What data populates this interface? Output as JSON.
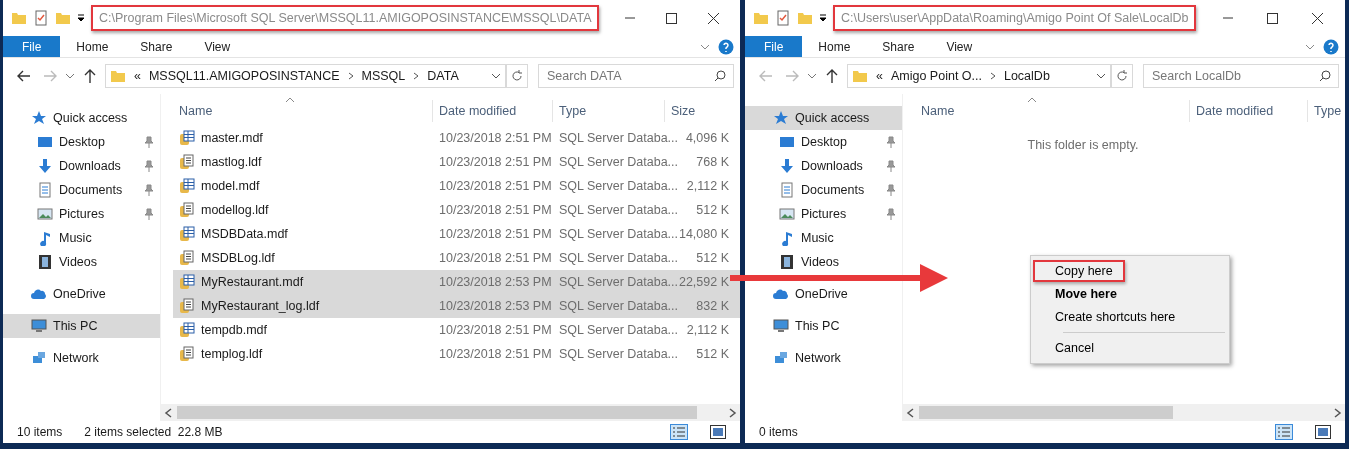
{
  "windows": [
    {
      "title_path": "C:\\Program Files\\Microsoft SQL Server\\MSSQL11.AMIGOPOSINSTANCE\\MSSQL\\DATA",
      "path_highlighted": true,
      "ribbon_tabs": [
        {
          "label": "File",
          "kind": "file"
        },
        {
          "label": "Home",
          "kind": "tab"
        },
        {
          "label": "Share",
          "kind": "tab"
        },
        {
          "label": "View",
          "kind": "tab"
        }
      ],
      "back_enabled": true,
      "breadcrumbs": [
        "«",
        "MSSQL11.AMIGOPOSINSTANCE",
        "MSSQL",
        "DATA"
      ],
      "search": {
        "placeholder": "Search DATA"
      },
      "sidebar": [
        {
          "label": "Quick access",
          "kind": "star",
          "selected": false,
          "children": [
            {
              "label": "Desktop",
              "kind": "desktop",
              "pinned": true,
              "selected": false
            },
            {
              "label": "Downloads",
              "kind": "download",
              "pinned": true,
              "selected": false
            },
            {
              "label": "Documents",
              "kind": "document",
              "pinned": true,
              "selected": false
            },
            {
              "label": "Pictures",
              "kind": "pictures",
              "pinned": true,
              "selected": false
            },
            {
              "label": "Music",
              "kind": "music",
              "pinned": false,
              "selected": false
            },
            {
              "label": "Videos",
              "kind": "video",
              "pinned": false,
              "selected": false
            }
          ]
        },
        {
          "label": "OneDrive",
          "kind": "cloud",
          "selected": false
        },
        {
          "label": "This PC",
          "kind": "pc",
          "selected": true
        },
        {
          "label": "Network",
          "kind": "network",
          "selected": false
        }
      ],
      "columns": [
        "Name",
        "Date modified",
        "Type",
        "Size"
      ],
      "files": [
        {
          "name": "master.mdf",
          "kind": "mdf",
          "date": "10/23/2018 2:51 PM",
          "type": "SQL Server Databa...",
          "size": "4,096 K",
          "selected": false
        },
        {
          "name": "mastlog.ldf",
          "kind": "ldf",
          "date": "10/23/2018 2:51 PM",
          "type": "SQL Server Databa...",
          "size": "768 K",
          "selected": false
        },
        {
          "name": "model.mdf",
          "kind": "mdf",
          "date": "10/23/2018 2:51 PM",
          "type": "SQL Server Databa...",
          "size": "2,112 K",
          "selected": false
        },
        {
          "name": "modellog.ldf",
          "kind": "ldf",
          "date": "10/23/2018 2:51 PM",
          "type": "SQL Server Databa...",
          "size": "512 K",
          "selected": false
        },
        {
          "name": "MSDBData.mdf",
          "kind": "mdf",
          "date": "10/23/2018 2:51 PM",
          "type": "SQL Server Databa...",
          "size": "14,080 K",
          "selected": false
        },
        {
          "name": "MSDBLog.ldf",
          "kind": "ldf",
          "date": "10/23/2018 2:51 PM",
          "type": "SQL Server Databa...",
          "size": "512 K",
          "selected": false
        },
        {
          "name": "MyRestaurant.mdf",
          "kind": "mdf",
          "date": "10/23/2018 2:53 PM",
          "type": "SQL Server Databa...",
          "size": "22,592 K",
          "selected": true
        },
        {
          "name": "MyRestaurant_log.ldf",
          "kind": "ldf",
          "date": "10/23/2018 2:53 PM",
          "type": "SQL Server Databa...",
          "size": "832 K",
          "selected": true
        },
        {
          "name": "tempdb.mdf",
          "kind": "mdf",
          "date": "10/23/2018 2:51 PM",
          "type": "SQL Server Databa...",
          "size": "2,112 K",
          "selected": false
        },
        {
          "name": "templog.ldf",
          "kind": "ldf",
          "date": "10/23/2018 2:51 PM",
          "type": "SQL Server Databa...",
          "size": "512 K",
          "selected": false
        }
      ],
      "status": {
        "count": "10 items",
        "selection": "2 items selected  22.8 MB"
      }
    },
    {
      "title_path": "C:\\Users\\user\\AppData\\Roaming\\Amigo Point Of Sale\\LocalDb",
      "path_highlighted": true,
      "ribbon_tabs": [
        {
          "label": "File",
          "kind": "file"
        },
        {
          "label": "Home",
          "kind": "tab"
        },
        {
          "label": "Share",
          "kind": "tab"
        },
        {
          "label": "View",
          "kind": "tab"
        }
      ],
      "back_enabled": false,
      "breadcrumbs": [
        "«",
        "Amigo Point O...",
        "LocalDb"
      ],
      "search": {
        "placeholder": "Search LocalDb"
      },
      "sidebar": [
        {
          "label": "Quick access",
          "kind": "star",
          "selected": true,
          "children": [
            {
              "label": "Desktop",
              "kind": "desktop",
              "pinned": true,
              "selected": false
            },
            {
              "label": "Downloads",
              "kind": "download",
              "pinned": true,
              "selected": false
            },
            {
              "label": "Documents",
              "kind": "document",
              "pinned": true,
              "selected": false
            },
            {
              "label": "Pictures",
              "kind": "pictures",
              "pinned": true,
              "selected": false
            },
            {
              "label": "Music",
              "kind": "music",
              "pinned": false,
              "selected": false
            },
            {
              "label": "Videos",
              "kind": "video",
              "pinned": false,
              "selected": false
            }
          ]
        },
        {
          "label": "OneDrive",
          "kind": "cloud",
          "selected": false
        },
        {
          "label": "This PC",
          "kind": "pc",
          "selected": false
        },
        {
          "label": "Network",
          "kind": "network",
          "selected": false
        }
      ],
      "columns": [
        "Name",
        "Date modified",
        "Type"
      ],
      "empty_message": "This folder is empty.",
      "status": {
        "count": "0 items"
      },
      "context_menu": {
        "items": [
          {
            "label": "Copy here",
            "kind": "item",
            "highlighted": true
          },
          {
            "label": "Move here",
            "kind": "default"
          },
          {
            "label": "Create shortcuts here",
            "kind": "item",
            "highlighted": false
          },
          {
            "label": "Cancel",
            "kind": "separated",
            "highlighted": false
          }
        ]
      }
    }
  ]
}
